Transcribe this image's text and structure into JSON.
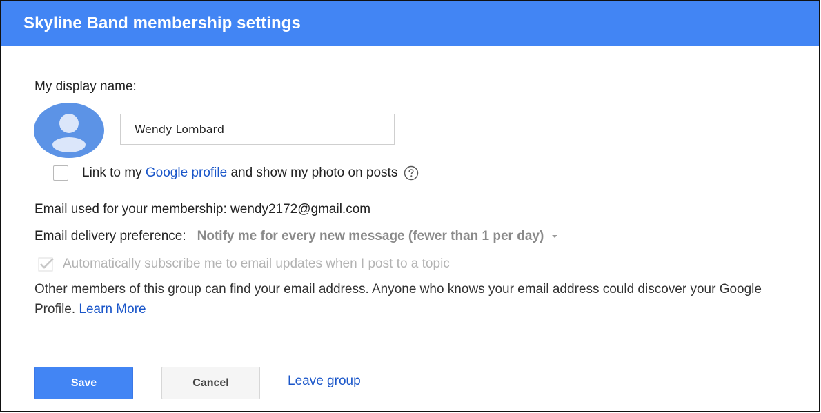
{
  "dialog": {
    "title": "Skyline Band membership settings"
  },
  "display_name": {
    "label": "My display name:",
    "value": "Wendy Lombard"
  },
  "profile_link": {
    "checked": false,
    "text_before": "Link to my",
    "link_text": "Google profile",
    "text_after": "and show my photo on posts"
  },
  "membership": {
    "email_text": "Email used for your membership: wendy2172@gmail.com"
  },
  "delivery": {
    "label": "Email delivery preference:",
    "selected": "Notify me for every new message (fewer than 1 per day)"
  },
  "auto_subscribe": {
    "checked": true,
    "disabled": true,
    "label": "Automatically subscribe me to email updates when I post to a topic"
  },
  "privacy": {
    "text": "Other members of this group can find your email address. Anyone who knows your email address could discover your Google Profile.",
    "link_text": "Learn More"
  },
  "actions": {
    "save_label": "Save",
    "cancel_label": "Cancel",
    "leave_label": "Leave group"
  },
  "colors": {
    "header_bg": "#4285f4",
    "link": "#1a56c9",
    "avatar_bg": "#5c93e6"
  },
  "icons": {
    "avatar": "person-silhouette-icon",
    "help": "question-circle-icon",
    "dropdown": "caret-down-icon",
    "check": "checkmark-icon"
  }
}
